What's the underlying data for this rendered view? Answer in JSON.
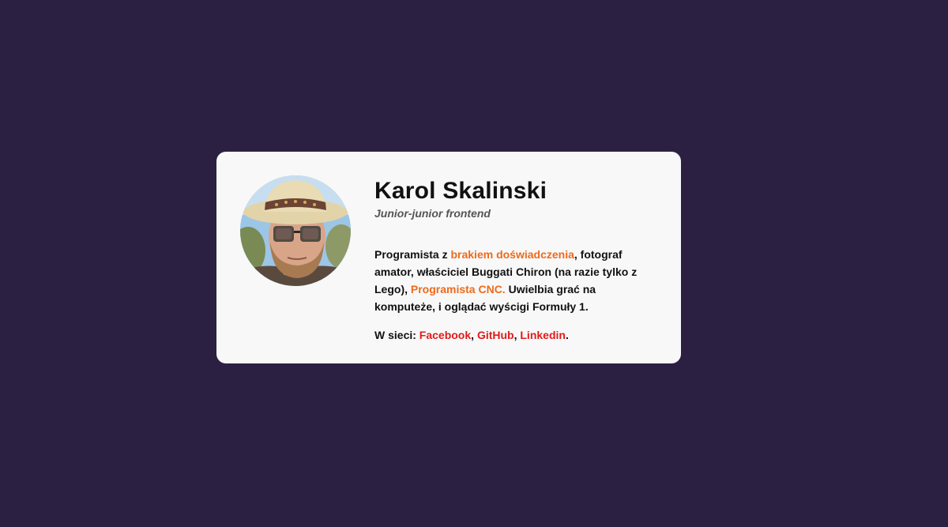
{
  "profile": {
    "name": "Karol Skalinski",
    "title": "Junior-junior frontend"
  },
  "bio": {
    "part1": "Programista z ",
    "link_experience": "brakiem doświadczenia",
    "part2": ", fotograf amator, właściciel Buggati Chiron (na razie tylko z Lego), ",
    "link_cnc": "Programista CNC.",
    "part3": " Uwielbia grać na komputeże, i oglądać wyścigi Formuły 1."
  },
  "social": {
    "prefix": "W sieci: ",
    "links": [
      "Facebook",
      "GitHub",
      "Linkedin"
    ],
    "separator": ", ",
    "suffix": "."
  },
  "colors": {
    "background": "#2c2042",
    "card": "#f8f8f8",
    "orange_link": "#ee6a1c",
    "red_link": "#e11a1a"
  }
}
